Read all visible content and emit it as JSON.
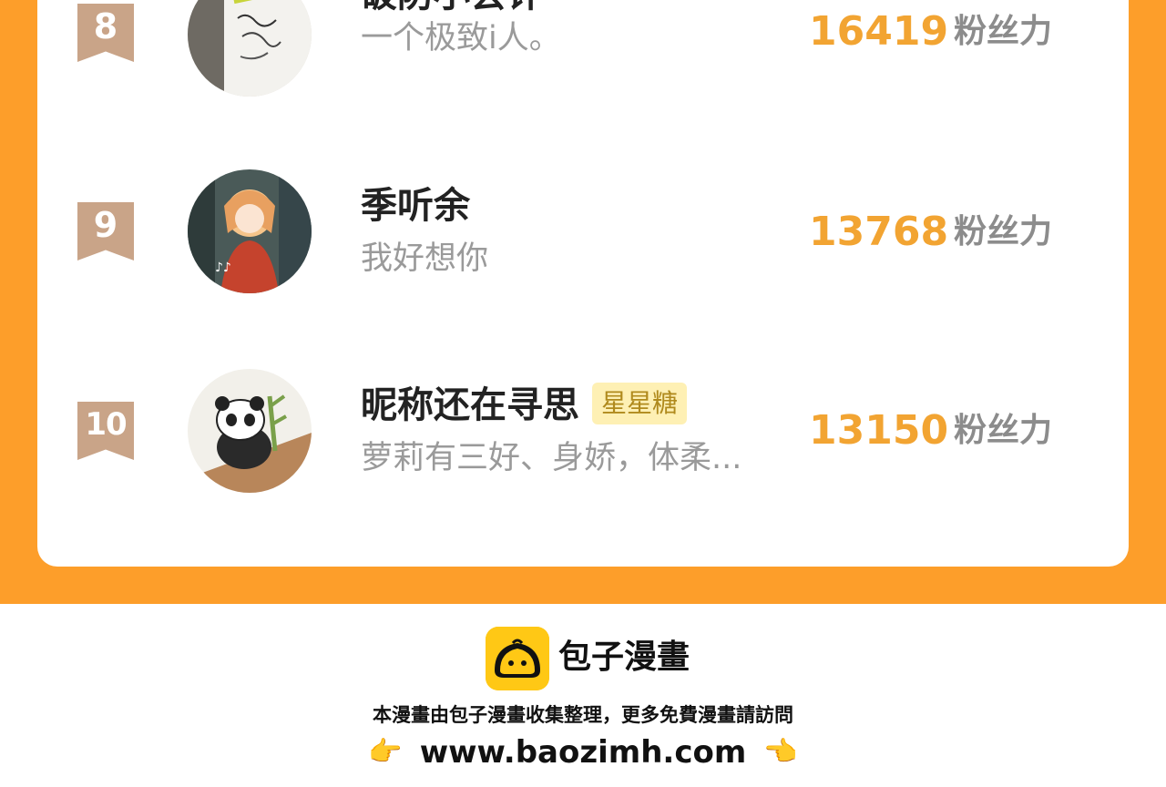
{
  "ranking": [
    {
      "rank": "8",
      "name": "破防小会计",
      "badge": "",
      "bio": "一个极致i人。",
      "score": "16419",
      "unit": "粉丝力"
    },
    {
      "rank": "9",
      "name": "季听余",
      "badge": "",
      "bio": "我好想你",
      "score": "13768",
      "unit": "粉丝力"
    },
    {
      "rank": "10",
      "name": "昵称还在寻思",
      "badge": "星星糖",
      "bio": "萝莉有三好、身娇，体柔...",
      "score": "13150",
      "unit": "粉丝力"
    }
  ],
  "footer": {
    "brand": "包子漫畫",
    "notice": "本漫畫由包子漫畫收集整理，更多免費漫畫請訪問",
    "url": "www.baozimh.com",
    "left_hand": "👉",
    "right_hand": "👈"
  },
  "colors": {
    "orange_bg": "#FD9E2A",
    "score": "#F2A432",
    "rank_ribbon": "#C9A488",
    "badge_bg": "#FEF0B4",
    "logo_yellow": "#FFC815"
  }
}
